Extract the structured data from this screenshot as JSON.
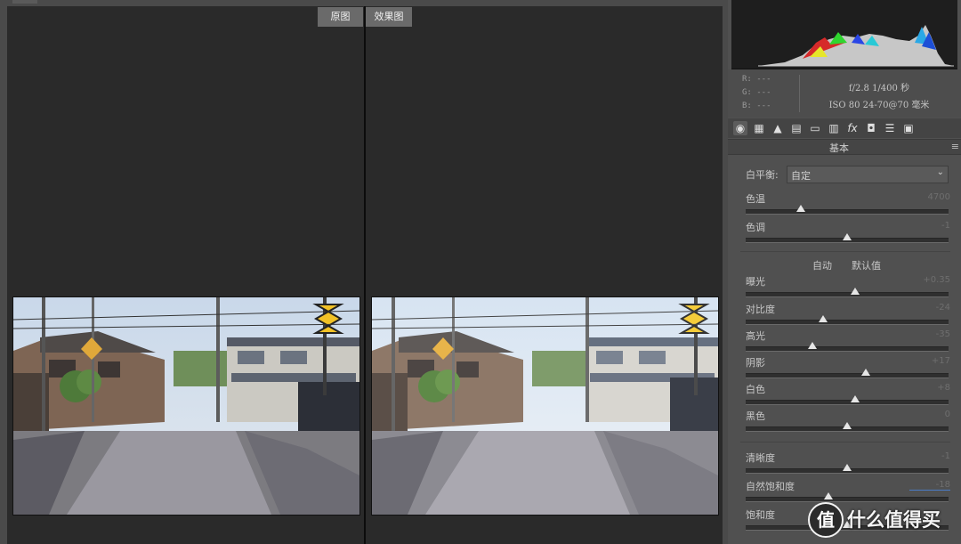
{
  "preview": {
    "before_label": "原图",
    "after_label": "效果图"
  },
  "readout": {
    "r": "R:  ---",
    "g": "G:  ---",
    "b": "B:  ---",
    "exif_line1": "f/2.8  1/400 秒",
    "exif_line2": "ISO 80  24-70@70 毫米"
  },
  "tabs": [
    "basic-icon",
    "tone-curve-icon",
    "detail-icon",
    "hsl-icon",
    "split-toning-icon",
    "lens-icon",
    "fx-icon",
    "camera-calibration-icon",
    "presets-icon",
    "snapshots-icon"
  ],
  "panel": {
    "section_title": "基本",
    "white_balance_label": "白平衡:",
    "white_balance_value": "自定",
    "auto_label": "自动",
    "default_label": "默认值",
    "sliders": [
      {
        "label": "色温",
        "value": "4700",
        "level": 0.27
      },
      {
        "label": "色调",
        "value": "-1",
        "level": 0.5
      },
      {
        "label": "曝光",
        "value": "+0.35",
        "level": 0.54
      },
      {
        "label": "对比度",
        "value": "-24",
        "level": 0.38
      },
      {
        "label": "高光",
        "value": "-35",
        "level": 0.33
      },
      {
        "label": "阴影",
        "value": "+17",
        "level": 0.59
      },
      {
        "label": "白色",
        "value": "+8",
        "level": 0.54
      },
      {
        "label": "黑色",
        "value": "0",
        "level": 0.5
      },
      {
        "label": "清晰度",
        "value": "-1",
        "level": 0.5
      },
      {
        "label": "自然饱和度",
        "value": "-18",
        "level": 0.41
      },
      {
        "label": "饱和度",
        "value": "",
        "level": 0.5
      }
    ]
  },
  "watermark": {
    "badge": "值",
    "text": "什么值得买"
  }
}
